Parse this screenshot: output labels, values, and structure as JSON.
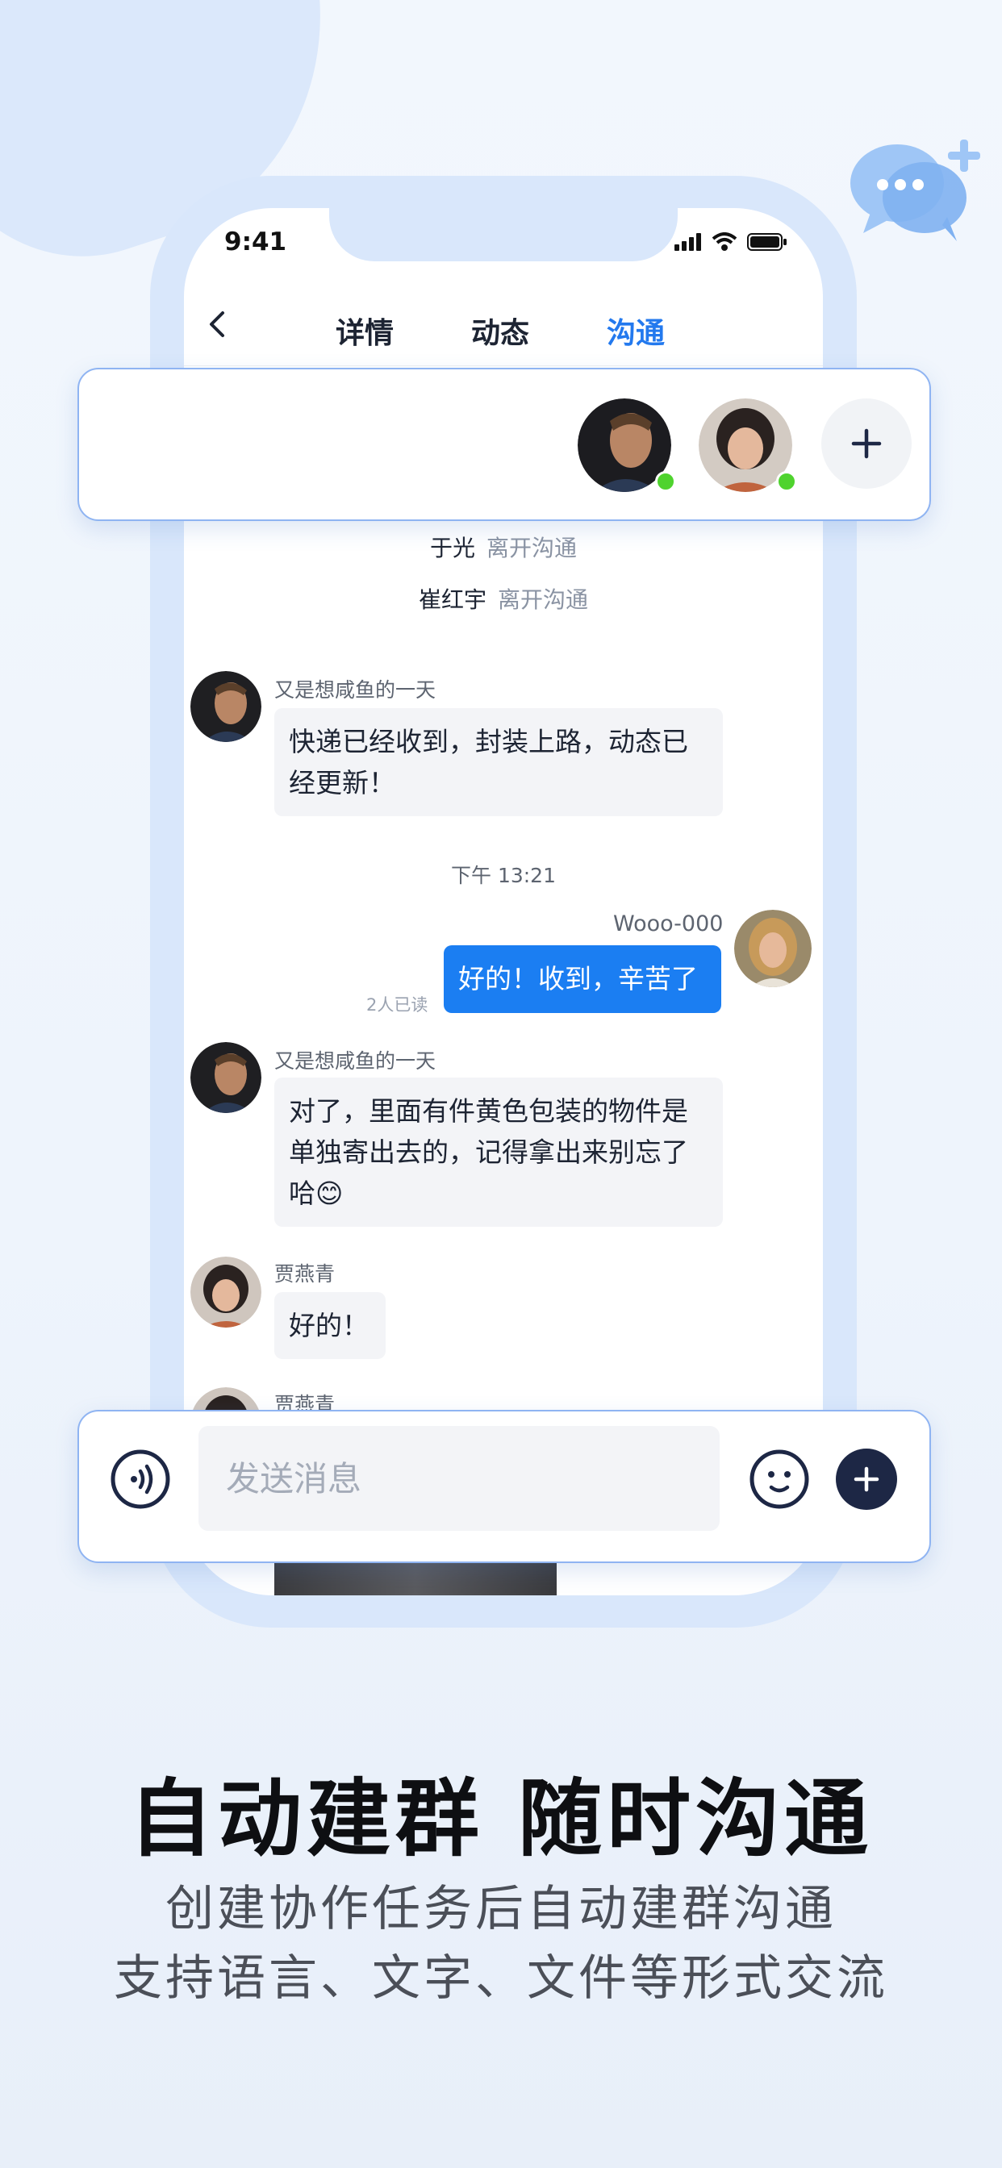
{
  "status_bar": {
    "time": "9:41"
  },
  "nav": {
    "tabs": [
      "详情",
      "动态",
      "沟通"
    ],
    "active_tab": "沟通"
  },
  "participants": {
    "avatars": [
      "man-dark-portrait",
      "woman-short-hair"
    ],
    "online": [
      true,
      true
    ]
  },
  "messages": {
    "system": [
      {
        "name": "于光",
        "text": "离开沟通"
      },
      {
        "name": "崔红宇",
        "text": "离开沟通"
      }
    ],
    "m1": {
      "sender": "又是想咸鱼的一天",
      "line1": "快递已经收到，封装上路，动态已",
      "line2": "经更新！"
    },
    "timestamp": "下午 13:21",
    "m2": {
      "sender": "Wooo-000",
      "text": "好的！收到，辛苦了",
      "read": "2人已读"
    },
    "m3": {
      "sender": "又是想咸鱼的一天",
      "line1": "对了，里面有件黄色包装的物件是",
      "line2": "单独寄出去的，记得拿出来别忘了",
      "line3": "哈😊"
    },
    "m4": {
      "sender": "贾燕青",
      "text": "好的！"
    },
    "m5": {
      "sender": "贾燕青"
    }
  },
  "input": {
    "placeholder": "发送消息"
  },
  "caption": {
    "headline": "自动建群 随时沟通",
    "sub1": "创建协作任务后自动建群沟通",
    "sub2": "支持语言、文字、文件等形式交流"
  },
  "colors": {
    "accent": "#2379ee",
    "bubble_me": "#1b7ef2",
    "online": "#4fd32e",
    "dark_button": "#1d2745"
  }
}
